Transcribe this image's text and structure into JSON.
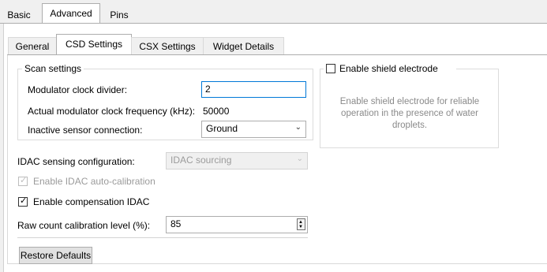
{
  "top_tabs": [
    {
      "label": "Basic"
    },
    {
      "label": "Advanced"
    },
    {
      "label": "Pins"
    }
  ],
  "sub_tabs": [
    {
      "label": "General"
    },
    {
      "label": "CSD Settings"
    },
    {
      "label": "CSX Settings"
    },
    {
      "label": "Widget Details"
    }
  ],
  "scan_settings": {
    "title": "Scan settings",
    "mod_clock_divider_label": "Modulator clock divider:",
    "mod_clock_divider_value": "2",
    "actual_freq_label": "Actual modulator clock frequency (kHz):",
    "actual_freq_value": "50000",
    "inactive_sensor_label": "Inactive sensor connection:",
    "inactive_sensor_value": "Ground"
  },
  "shield": {
    "checkbox_label": "Enable shield electrode",
    "checked": false,
    "info_lines": [
      "Enable shield electrode for reliable",
      "operation in the presence of water",
      "droplets."
    ]
  },
  "idac": {
    "config_label": "IDAC sensing configuration:",
    "config_value": "IDAC sourcing",
    "auto_cal_label": "Enable IDAC auto-calibration",
    "auto_cal_checked": true,
    "compensation_label": "Enable compensation IDAC",
    "compensation_checked": true,
    "raw_count_label": "Raw count calibration level (%):",
    "raw_count_value": "85"
  },
  "restore_button": "Restore Defaults"
}
